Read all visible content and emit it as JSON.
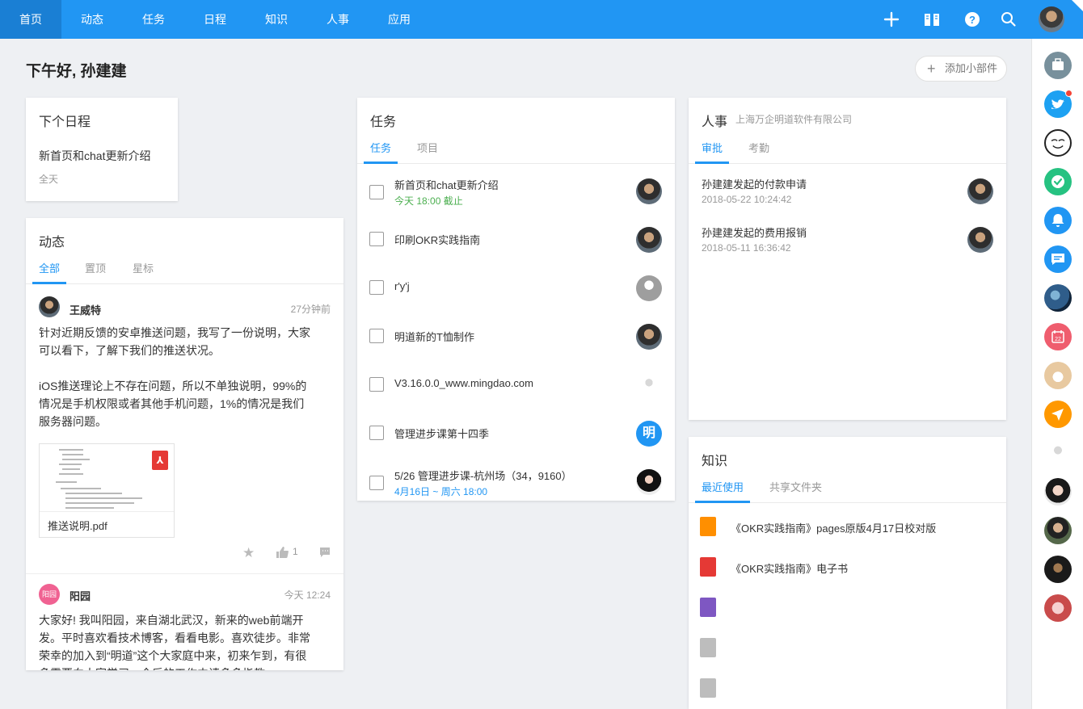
{
  "nav": {
    "items": [
      "首页",
      "动态",
      "任务",
      "日程",
      "知识",
      "人事",
      "应用"
    ],
    "active": "首页"
  },
  "topbar_icons": [
    "plus-icon",
    "book-icon",
    "help-icon",
    "search-icon",
    "avatar"
  ],
  "greeting": "下午好, 孙建建",
  "add_widget_label": "添加小部件",
  "schedule": {
    "title": "下个日程",
    "event": "新首页和chat更新介绍",
    "time": "全天"
  },
  "feed": {
    "title": "动态",
    "tabs": [
      "全部",
      "置顶",
      "星标"
    ],
    "posts": [
      {
        "author": "王威特",
        "time": "27分钟前",
        "text": "针对近期反馈的安卓推送问题，我写了一份说明，大家\n可以看下，了解下我们的推送状况。\n\niOS推送理论上不存在问题，所以不单独说明，99%的\n情况是手机权限或者其他手机问题，1%的情况是我们\n服务器问题。",
        "attachment": "推送说明.pdf",
        "likes": "1"
      },
      {
        "author": "阳园",
        "avatar_text": "阳园",
        "time": "今天 12:24",
        "text": "大家好! 我叫阳园，来自湖北武汉，新来的web前端开\n发。平时喜欢看技术博客，看看电影。喜欢徒步。非常\n荣幸的加入到“明道”这个大家庭中来，初来乍到，有很\n多需要向大家学习，今后的工作中请多多指教。"
      }
    ]
  },
  "tasks": {
    "title": "任务",
    "tabs": [
      "任务",
      "项目"
    ],
    "items": [
      {
        "name": "新首页和chat更新介绍",
        "due": "今天 18:00 截止",
        "due_color": "green",
        "avatar": "person"
      },
      {
        "name": "印刷OKR实践指南",
        "due": "",
        "avatar": "person"
      },
      {
        "name": "r'y'j",
        "due": "",
        "avatar": "grey"
      },
      {
        "name": "明道新的T恤制作",
        "due": "",
        "avatar": "person"
      },
      {
        "name": "V3.16.0.0_www.mingdao.com",
        "due": "",
        "avatar": "pale"
      },
      {
        "name": "管理进步课第十四季",
        "due": "",
        "avatar": "ming",
        "avatar_text": "明"
      },
      {
        "name": "5/26 管理进步课-杭州场（34，9160）",
        "due": "4月16日 ~ 周六 18:00",
        "due_color": "blue",
        "avatar": "girl"
      }
    ]
  },
  "hr": {
    "title": "人事",
    "company": "上海万企明道软件有限公司",
    "tabs": [
      "审批",
      "考勤"
    ],
    "items": [
      {
        "name": "孙建建发起的付款申请",
        "time": "2018-05-22 10:24:42"
      },
      {
        "name": "孙建建发起的费用报销",
        "time": "2018-05-11 16:36:42"
      }
    ]
  },
  "knowledge": {
    "title": "知识",
    "tabs": [
      "最近使用",
      "共享文件夹"
    ],
    "files": [
      {
        "name": "《OKR实践指南》pages原版4月17日校对版",
        "icon": "pages-icon",
        "color": "#ff8f00"
      },
      {
        "name": "《OKR实践指南》电子书",
        "icon": "pdf-icon",
        "color": "#e53935"
      },
      {
        "name": "",
        "icon": "video-icon",
        "color": "#7e57c2"
      },
      {
        "name": "",
        "icon": "doc-icon",
        "color": "#bdbdbd"
      },
      {
        "name": "",
        "icon": "doc-icon",
        "color": "#bdbdbd"
      }
    ]
  },
  "rail": {
    "icons": [
      {
        "name": "briefcase-icon",
        "color": "#78909c"
      },
      {
        "name": "twitter-icon",
        "color": "#1da1f2"
      },
      {
        "name": "troll-face-icon",
        "color": "#ffffff"
      },
      {
        "name": "check-icon",
        "color": "#26c281"
      },
      {
        "name": "bell-icon",
        "color": "#2196f3"
      },
      {
        "name": "chat-icon",
        "color": "#2196f3"
      },
      {
        "name": "earth-icon",
        "color": "#3a5f8a"
      },
      {
        "name": "calendar-icon",
        "color": "#ef5d6e"
      },
      {
        "name": "cat-avatar",
        "color": "#e8c9a0"
      },
      {
        "name": "send-icon",
        "color": "#ff9800"
      },
      {
        "name": "pale-avatar",
        "color": "#f4f4f4"
      },
      {
        "name": "girl-avatar",
        "color": "#d9c2b8"
      },
      {
        "name": "man-avatar",
        "color": "#6d7a5e"
      },
      {
        "name": "dark-avatar",
        "color": "#2b2b2b"
      },
      {
        "name": "money-avatar",
        "color": "#e4a4a4"
      }
    ],
    "calendar_day": "22"
  }
}
